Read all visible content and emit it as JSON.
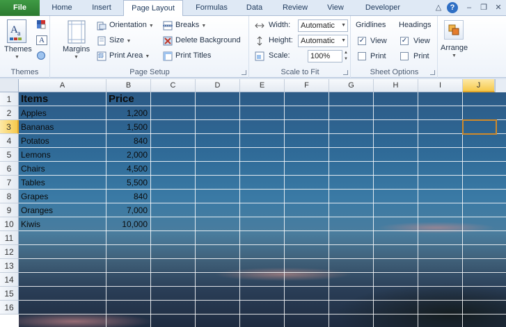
{
  "tabs": [
    {
      "label": "File"
    },
    {
      "label": "Home"
    },
    {
      "label": "Insert"
    },
    {
      "label": "Page Layout"
    },
    {
      "label": "Formulas"
    },
    {
      "label": "Data"
    },
    {
      "label": "Review"
    },
    {
      "label": "View"
    },
    {
      "label": "Developer"
    }
  ],
  "window_controls": {
    "minimize_ribbon": "△",
    "help": "?",
    "minimize": "–",
    "restore": "❐",
    "close": "✕"
  },
  "ribbon": {
    "themes": {
      "themes_label": "Themes",
      "group_label": "Themes"
    },
    "page_setup": {
      "margins": "Margins",
      "orientation": "Orientation",
      "size": "Size",
      "print_area": "Print Area",
      "breaks": "Breaks",
      "delete_background": "Delete Background",
      "print_titles": "Print Titles",
      "group_label": "Page Setup"
    },
    "scale_to_fit": {
      "width_label": "Width:",
      "width_value": "Automatic",
      "height_label": "Height:",
      "height_value": "Automatic",
      "scale_label": "Scale:",
      "scale_value": "100%",
      "group_label": "Scale to Fit"
    },
    "sheet_options": {
      "gridlines": "Gridlines",
      "headings": "Headings",
      "gridlines_view": "View",
      "gridlines_print": "Print",
      "headings_view": "View",
      "headings_print": "Print",
      "gridlines_view_checked": true,
      "gridlines_print_checked": false,
      "headings_view_checked": true,
      "headings_print_checked": false,
      "group_label": "Sheet Options"
    },
    "arrange": {
      "label": "Arrange"
    }
  },
  "sheet": {
    "columns": [
      "A",
      "B",
      "C",
      "D",
      "E",
      "F",
      "G",
      "H",
      "I",
      "J"
    ],
    "rows": [
      "1",
      "2",
      "3",
      "4",
      "5",
      "6",
      "7",
      "8",
      "9",
      "10",
      "11",
      "12",
      "13",
      "14",
      "15",
      "16"
    ],
    "active_column": "J",
    "active_row": "3",
    "header": {
      "items": "Items",
      "price": "Price"
    },
    "data": [
      {
        "item": "Apples",
        "price": "1,200"
      },
      {
        "item": "Bananas",
        "price": "1,500"
      },
      {
        "item": "Potatos",
        "price": "840"
      },
      {
        "item": "Lemons",
        "price": "2,000"
      },
      {
        "item": "Chairs",
        "price": "4,500"
      },
      {
        "item": "Tables",
        "price": "5,500"
      },
      {
        "item": "Grapes",
        "price": "840"
      },
      {
        "item": "Oranges",
        "price": "7,000"
      },
      {
        "item": "Kiwis",
        "price": "10,000"
      }
    ]
  },
  "colors": {
    "file_tab": "#2b7a2f",
    "selection": "#d08a2a",
    "header_highlight": "#f6c94c"
  }
}
